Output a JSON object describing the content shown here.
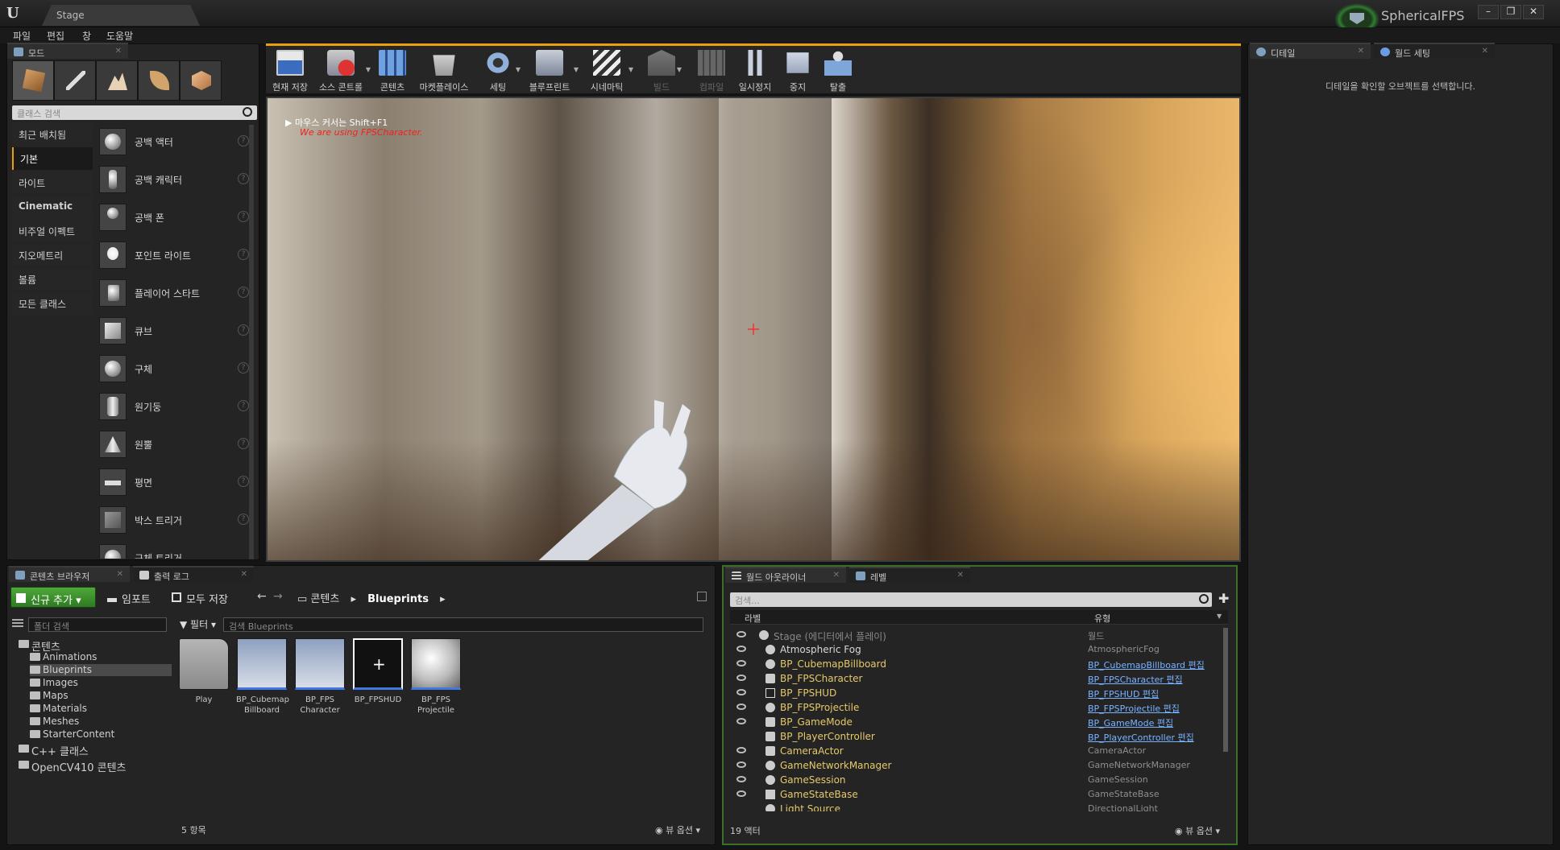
{
  "title_bar": {
    "doc_tab": "Stage",
    "project_name": "SphericalFPS",
    "window_buttons": [
      "–",
      "❐",
      "✕"
    ]
  },
  "menu": [
    "파일",
    "편집",
    "창",
    "도움말"
  ],
  "modes_panel": {
    "tab": "모드",
    "mode_icons": [
      "place-mode-icon",
      "paint-mode-icon",
      "landscape-mode-icon",
      "foliage-mode-icon",
      "geometry-mode-icon"
    ],
    "search_placeholder": "클래스 검색",
    "categories": [
      "최근 배치됨",
      "기본",
      "라이트",
      "Cinematic",
      "비주얼 이펙트",
      "지오메트리",
      "볼륨",
      "모든 클래스"
    ],
    "active_category": "기본",
    "items": [
      "공백 액터",
      "공백 캐릭터",
      "공백 폰",
      "포인트 라이트",
      "플레이어 스타트",
      "큐브",
      "구체",
      "원기둥",
      "원뿔",
      "평면",
      "박스 트리거",
      "구체 트리거"
    ]
  },
  "toolbar": {
    "buttons": [
      {
        "label": "현재 저장",
        "icon": "save-icon",
        "enabled": true
      },
      {
        "label": "소스 콘트롤",
        "icon": "source-control-icon",
        "enabled": true,
        "dropdown": true
      },
      {
        "label": "콘텐츠",
        "icon": "content-icon",
        "enabled": true
      },
      {
        "label": "마켓플레이스",
        "icon": "marketplace-icon",
        "enabled": true
      },
      {
        "label": "세팅",
        "icon": "settings-icon",
        "enabled": true,
        "dropdown": true
      },
      {
        "label": "블루프린트",
        "icon": "blueprint-icon",
        "enabled": true,
        "dropdown": true
      },
      {
        "label": "시네마틱",
        "icon": "cinematic-icon",
        "enabled": true,
        "dropdown": true
      },
      {
        "label": "빌드",
        "icon": "build-icon",
        "enabled": false,
        "dropdown": true
      },
      {
        "label": "컴파일",
        "icon": "compile-icon",
        "enabled": false
      },
      {
        "label": "일시정지",
        "icon": "pause-icon",
        "enabled": true
      },
      {
        "label": "중지",
        "icon": "stop-icon",
        "enabled": true
      },
      {
        "label": "탈출",
        "icon": "eject-icon",
        "enabled": true
      }
    ],
    "accent": "#e8a10d"
  },
  "viewport": {
    "hint": "마우스 커서는 Shift+F1",
    "debug_text": "We are using FPSCharacter."
  },
  "details_panel": {
    "tabs": [
      "디테일",
      "월드 세팅"
    ],
    "empty_message": "디테일을 확인할 오브젝트를 선택합니다."
  },
  "content_browser": {
    "tabs": [
      "콘텐츠 브라우저",
      "출력 로그"
    ],
    "add_new": "신규 추가",
    "import": "임포트",
    "save_all": "모두 저장",
    "path_root": "콘텐츠",
    "path_current": "Blueprints",
    "folder_search_placeholder": "폴더 검색",
    "filter_label": "필터",
    "asset_search_placeholder": "검색 Blueprints",
    "tree": [
      {
        "label": "콘텐츠",
        "level": 0,
        "expanded": true
      },
      {
        "label": "Animations",
        "level": 1
      },
      {
        "label": "Blueprints",
        "level": 1,
        "selected": true
      },
      {
        "label": "Images",
        "level": 1
      },
      {
        "label": "Maps",
        "level": 1
      },
      {
        "label": "Materials",
        "level": 1
      },
      {
        "label": "Meshes",
        "level": 1
      },
      {
        "label": "StarterContent",
        "level": 1
      },
      {
        "label": "C++ 클래스",
        "level": 0
      },
      {
        "label": "OpenCV410 콘텐츠",
        "level": 0
      }
    ],
    "assets": [
      {
        "label": "Play",
        "kind": "folder"
      },
      {
        "label": "BP_Cubemap Billboard",
        "kind": "blueprint"
      },
      {
        "label": "BP_FPS Character",
        "kind": "blueprint"
      },
      {
        "label": "BP_FPSHUD",
        "kind": "hud"
      },
      {
        "label": "BP_FPS Projectile",
        "kind": "sphere"
      }
    ],
    "item_count": "5 항목",
    "view_options": "뷰 옵션"
  },
  "outliner": {
    "tabs": [
      "월드 아웃라이너",
      "레벨"
    ],
    "search_placeholder": "검색...",
    "col_label": "라벨",
    "col_type": "유형",
    "rows": [
      {
        "name": "Stage (에디터에서 플레이)",
        "type": "월드",
        "root": true
      },
      {
        "name": "Atmospheric Fog",
        "type": "AtmosphericFog"
      },
      {
        "name": "BP_CubemapBillboard",
        "type": "BP_CubemapBillboard 편집",
        "bp": true
      },
      {
        "name": "BP_FPSCharacter",
        "type": "BP_FPSCharacter 편집",
        "bp": true
      },
      {
        "name": "BP_FPSHUD",
        "type": "BP_FPSHUD 편집",
        "bp": true
      },
      {
        "name": "BP_FPSProjectile",
        "type": "BP_FPSProjectile 편집",
        "bp": true
      },
      {
        "name": "BP_GameMode",
        "type": "BP_GameMode 편집",
        "bp": true
      },
      {
        "name": "BP_PlayerController",
        "type": "BP_PlayerController 편집",
        "bp": true
      },
      {
        "name": "CameraActor",
        "type": "CameraActor"
      },
      {
        "name": "GameNetworkManager",
        "type": "GameNetworkManager"
      },
      {
        "name": "GameSession",
        "type": "GameSession"
      },
      {
        "name": "GameStateBase",
        "type": "GameStateBase"
      },
      {
        "name": "Light Source",
        "type": "DirectionalLight"
      }
    ],
    "actor_count": "19 액터",
    "view_options": "뷰 옵션"
  }
}
